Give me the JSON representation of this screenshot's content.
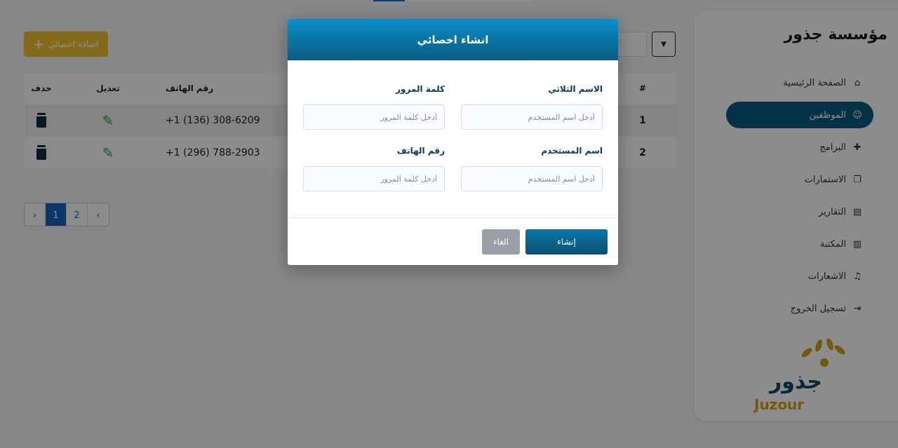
{
  "sidebar": {
    "brand": "مؤسسة جذور",
    "items": [
      {
        "label": "الصفحة الرئيسية",
        "icon": "home-icon"
      },
      {
        "label": "الموظفين",
        "icon": "users-icon",
        "active": true
      },
      {
        "label": "البرامج",
        "icon": "puzzle-icon"
      },
      {
        "label": "الاستمارات",
        "icon": "forms-icon"
      },
      {
        "label": "التقارير",
        "icon": "file-icon"
      },
      {
        "label": "المكتبة",
        "icon": "book-icon"
      },
      {
        "label": "الاشعارات",
        "icon": "bell-icon"
      },
      {
        "label": "تسجيل الخروج",
        "icon": "logout-icon"
      }
    ],
    "logo": {
      "arabic": "جذور",
      "latin": "Juzour"
    }
  },
  "toolbar": {
    "add_label": "اضافة اخصائي"
  },
  "table": {
    "headers": {
      "delete": "حذف",
      "edit": "تعديل",
      "phone": "رقم الهاتف",
      "number": "#"
    },
    "rows": [
      {
        "number": "1",
        "phone": "+1 (136) 308-6209"
      },
      {
        "number": "2",
        "phone": "+1 (296) 788-2903"
      }
    ]
  },
  "pagination": {
    "prev": "‹",
    "pages": [
      "1",
      "2"
    ],
    "current": "1",
    "next": "›"
  },
  "modal": {
    "title": "انشاء اخصائي",
    "fields": {
      "full_name": {
        "label": "الاسم الثلاثي",
        "placeholder": "أدخل اسم المستخدم"
      },
      "password": {
        "label": "كلمة المرور",
        "placeholder": "أدخل كلمة المرور"
      },
      "username": {
        "label": "اسم المستخدم",
        "placeholder": "أدخل اسم المستخدم"
      },
      "phone": {
        "label": "رقم الهاتف",
        "placeholder": "أدخل كلمة المرور"
      }
    },
    "create_label": "إنشاء",
    "cancel_label": "الغاء"
  },
  "colors": {
    "primary": "#0b5c82",
    "accent": "#f1c232",
    "edit": "#2e9b3a",
    "delete": "#0b2f44"
  }
}
